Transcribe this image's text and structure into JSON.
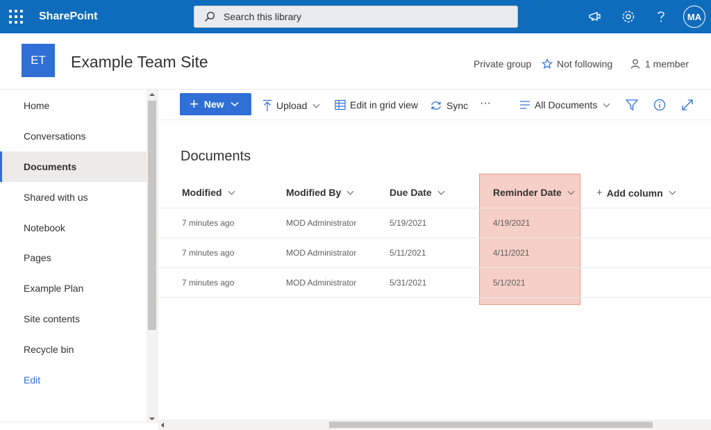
{
  "suitebar": {
    "app_name": "SharePoint",
    "search_placeholder": "Search this library",
    "avatar_initials": "MA",
    "background": "#0f6cbd"
  },
  "site": {
    "logo_initials": "ET",
    "title": "Example Team Site",
    "privacy": "Private group",
    "follow": "Not following",
    "members": "1 member"
  },
  "nav": {
    "items": [
      {
        "label": "Home"
      },
      {
        "label": "Conversations"
      },
      {
        "label": "Documents"
      },
      {
        "label": "Shared with us"
      },
      {
        "label": "Notebook"
      },
      {
        "label": "Pages"
      },
      {
        "label": "Example Plan"
      },
      {
        "label": "Site contents"
      },
      {
        "label": "Recycle bin"
      },
      {
        "label": "Edit"
      }
    ],
    "selected": "Documents"
  },
  "commandbar": {
    "new": "New",
    "upload": "Upload",
    "grid": "Edit in grid view",
    "sync": "Sync",
    "more": "···",
    "view": "All Documents"
  },
  "library": {
    "title": "Documents",
    "columns": [
      "Modified",
      "Modified By",
      "Due Date",
      "Reminder Date",
      "Add column"
    ],
    "rows": [
      {
        "modified": "7 minutes ago",
        "modified_by": "MOD Administrator",
        "due": "5/19/2021",
        "reminder": "4/19/2021"
      },
      {
        "modified": "7 minutes ago",
        "modified_by": "MOD Administrator",
        "due": "5/11/2021",
        "reminder": "4/11/2021"
      },
      {
        "modified": "7 minutes ago",
        "modified_by": "MOD Administrator",
        "due": "5/31/2021",
        "reminder": "5/1/2021"
      }
    ]
  },
  "colors": {
    "accent": "#2f6fd6",
    "highlight": "#e88068"
  }
}
